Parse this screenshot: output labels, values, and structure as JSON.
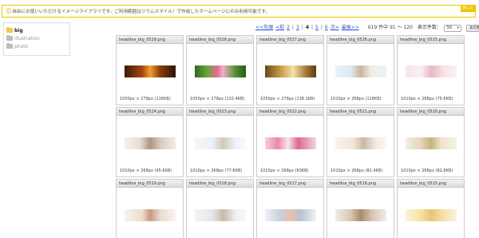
{
  "notice": {
    "text": "自由にお使いいただけるイメージライブラリです。ご利用範囲はリウムスマイル！で作成したホームページにのみ利用可能です。",
    "close_label": "閉じる",
    "accent_color": "#f0c400"
  },
  "sidebar": {
    "folders": [
      {
        "label": "big",
        "active": true
      },
      {
        "label": "illustration",
        "active": false
      },
      {
        "label": "photo",
        "active": false
      }
    ]
  },
  "pager": {
    "first": "<<先頭",
    "prev": "<前",
    "pages": [
      "2",
      "3",
      "4",
      "5",
      "6"
    ],
    "current_page": "4",
    "next": "次>",
    "last": "最後>>",
    "count": "619 件中 91 〜 120",
    "per_label": "表示件数：",
    "per_value": "30",
    "apply_label": "表示数変更"
  },
  "cards": [
    {
      "name": "headline_big_0529.png",
      "size": "1050px × 278px (116KB)",
      "thumb": "sunset"
    },
    {
      "name": "headline_big_0528.png",
      "size": "1050px × 278px (132.4KB)",
      "thumb": "lotus"
    },
    {
      "name": "headline_big_0527.png",
      "size": "1050px × 278px (138.1KB)",
      "thumb": "buddha"
    },
    {
      "name": "headline_big_0526.png",
      "size": "1010px × 268px (118KB)",
      "thumb": "spa-light"
    },
    {
      "name": "headline_big_0525.png",
      "size": "1010px × 268px (75.6KB)",
      "thumb": "pink-pale"
    },
    {
      "name": "headline_big_0524.png",
      "size": "1010px × 268px (95.6KB)",
      "thumb": "massage"
    },
    {
      "name": "headline_big_0523.png",
      "size": "1010px × 268px (77.6KB)",
      "thumb": "woman-white"
    },
    {
      "name": "headline_big_0522.png",
      "size": "1010px × 268px (83KB)",
      "thumb": "flowers-pink"
    },
    {
      "name": "headline_big_0521.png",
      "size": "1010px × 268px (82.4KB)",
      "thumb": "woman-pale"
    },
    {
      "name": "headline_big_0520.png",
      "size": "1010px × 268px (82.8KB)",
      "thumb": "spa-items"
    },
    {
      "name": "headline_big_0519.png",
      "size": "",
      "thumb": "hands"
    },
    {
      "name": "headline_big_0518.png",
      "size": "",
      "thumb": "woman-bed"
    },
    {
      "name": "headline_big_0517.png",
      "size": "",
      "thumb": "feet"
    },
    {
      "name": "headline_big_0516.png",
      "size": "",
      "thumb": "lying"
    },
    {
      "name": "headline_big_0515.png",
      "size": "",
      "thumb": "yellow-woman"
    }
  ],
  "thumb_gradients": {
    "sunset": "linear-gradient(90deg,#3a1a08 0%,#a54a10 35%,#f0a030 50%,#8a3a0c 70%,#2a1206 100%)",
    "lotus": "linear-gradient(90deg,#2f6a1e 0%,#6aa63c 25%,#e86a9a 45%,#f4b0c8 55%,#4f8f2c 80%,#2a5a18 100%)",
    "buddha": "linear-gradient(90deg,#6a4a1c 0%,#c79a46 30%,#f4e2a8 55%,#a87a34 80%,#5a3c14 100%)",
    "spa-light": "linear-gradient(90deg,#eaf2fb 0%,#dfe9f5 30%,#c8b69a 50%,#f2ece2 70%,#eaf2fb 100%)",
    "pink-pale": "linear-gradient(90deg,#f7e6ea 0%,#fbeff1 30%,#e8b8c4 50%,#f6e4e8 75%,#fbf1f3 100%)",
    "massage": "linear-gradient(90deg,#f4f2ee 0%,#e6ddd2 30%,#b09580 50%,#d9cbbd 70%,#f1ede8 100%)",
    "woman-white": "linear-gradient(90deg,#f6f7f9 0%,#eceff3 35%,#d6c8b8 55%,#f0f2f5 80%,#f8f9fb 100%)",
    "flowers-pink": "linear-gradient(90deg,#f6d0dc 0%,#e88aa8 25%,#f8e6ee 45%,#d86a90 65%,#f6d6e0 100%)",
    "woman-pale": "linear-gradient(90deg,#f7f3ef 0%,#efe7df 35%,#cdb7a2 55%,#f3ece6 80%,#faf7f4 100%)",
    "spa-items": "linear-gradient(90deg,#f3efe6 0%,#e2d6bc 30%,#c8b27e 50%,#efe4cc 70%,#f6f2ea 100%)",
    "hands": "linear-gradient(90deg,#f7f3ef 0%,#ecdccc 35%,#c89880 50%,#eadcd0 70%,#f8f4f0 100%)",
    "woman-bed": "linear-gradient(90deg,#f2f4f6 0%,#e4e6ea 35%,#cbb7a4 55%,#eef0f2 80%,#f6f7f8 100%)",
    "feet": "linear-gradient(90deg,#eef2f6 0%,#c8d0dc 30%,#e8c0ac 50%,#b8c4d0 70%,#eef2f6 100%)",
    "lying": "linear-gradient(90deg,#f1ede8 0%,#d8c8b4 30%,#a88a6c 50%,#d4c2ae 70%,#f1ede8 100%)",
    "yellow-woman": "linear-gradient(90deg,#fbf3d8 0%,#f6e2a0 30%,#e8c47a 50%,#f4dca0 70%,#fbf4dc 100%)"
  }
}
